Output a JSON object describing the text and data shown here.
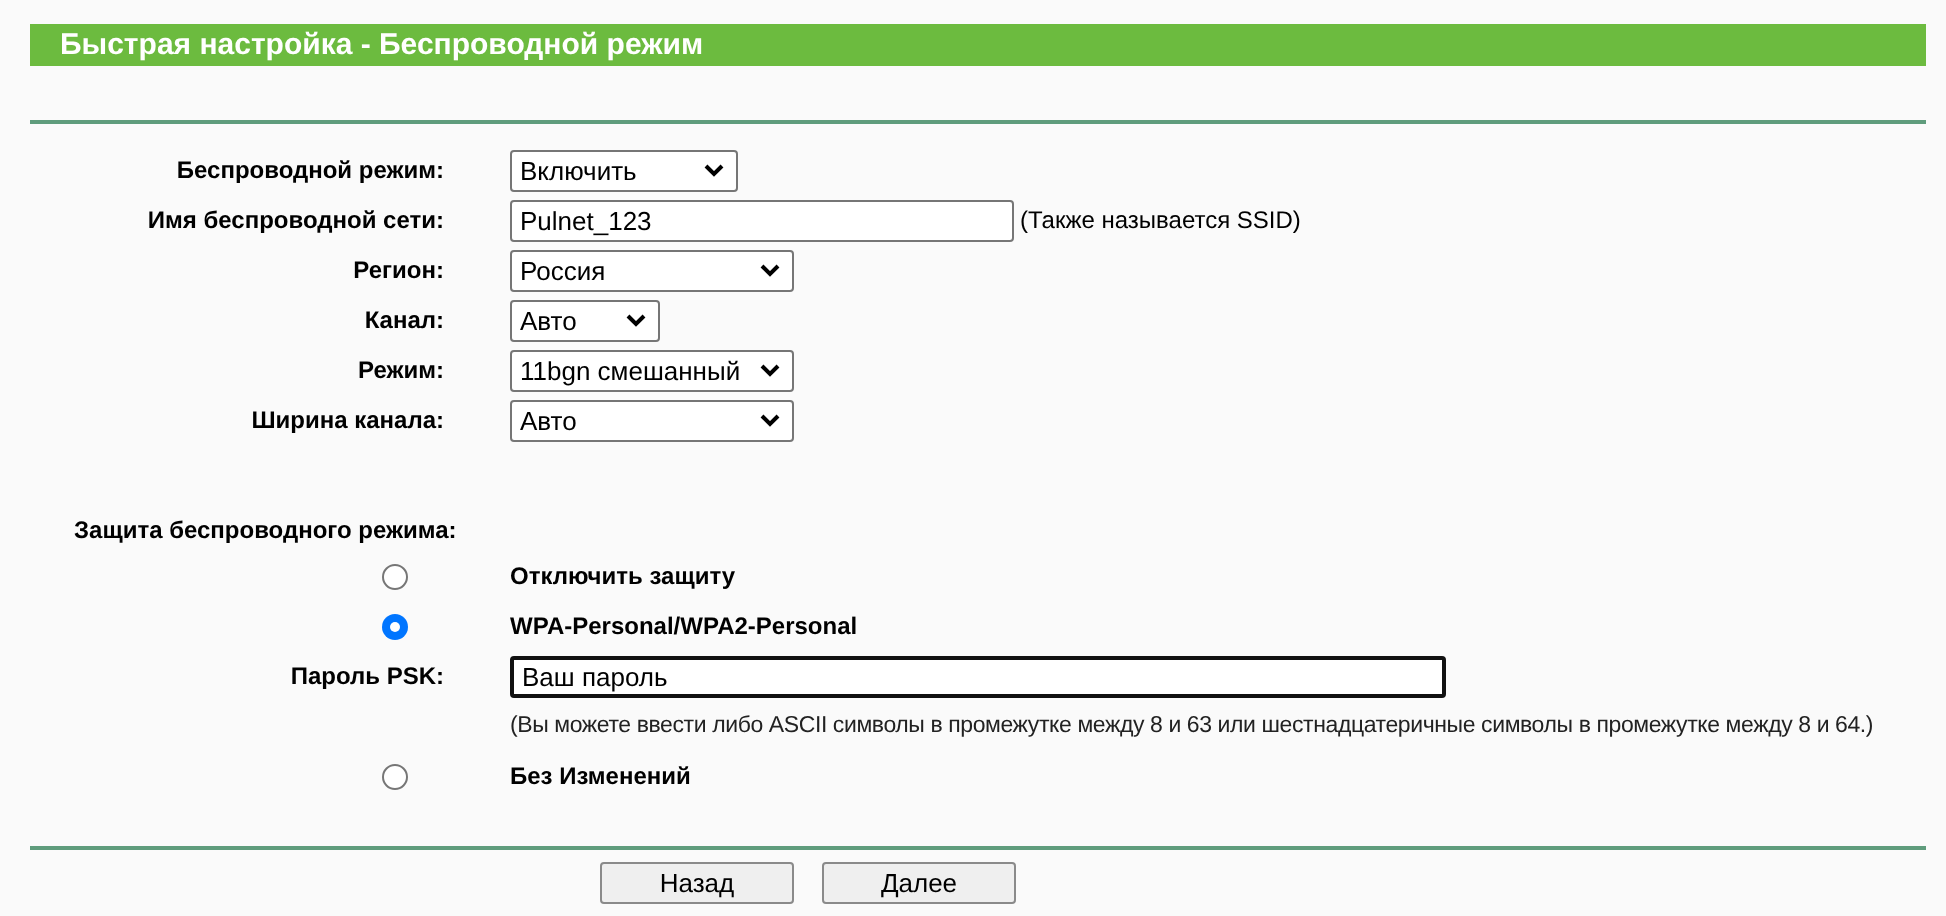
{
  "title": "Быстрая настройка - Беспроводной режим",
  "fields": [
    {
      "kind": "select",
      "label": "Беспроводной режим:",
      "value": "Включить"
    },
    {
      "kind": "text",
      "label": "Имя беспроводной сети:",
      "value": "Pulnet_123",
      "note": "(Также называется SSID)"
    },
    {
      "kind": "select",
      "label": "Регион:",
      "value": "Россия"
    },
    {
      "kind": "select",
      "label": "Канал:",
      "value": "Авто"
    },
    {
      "kind": "select",
      "label": "Режим:",
      "value": "11bgn смешанный"
    },
    {
      "kind": "select",
      "label": "Ширина канала:",
      "value": "Авто"
    }
  ],
  "security": {
    "label": "Защита беспроводного режима:",
    "items": [
      {
        "kind": "radio",
        "label": "Отключить защиту",
        "selected": false
      },
      {
        "kind": "radio",
        "label": "WPA-Personal/WPA2-Personal",
        "selected": true
      },
      {
        "kind": "password",
        "label": "Пароль PSK:",
        "value": "Ваш пароль",
        "hint": "(Вы можете ввести либо ASCII символы в промежутке между 8 и 63 или шестнадцатеричные символы в промежутке между 8 и 64.)"
      },
      {
        "kind": "radio",
        "label": "Без Изменений",
        "selected": false
      }
    ]
  },
  "buttons": [
    "Назад",
    "Далее"
  ]
}
